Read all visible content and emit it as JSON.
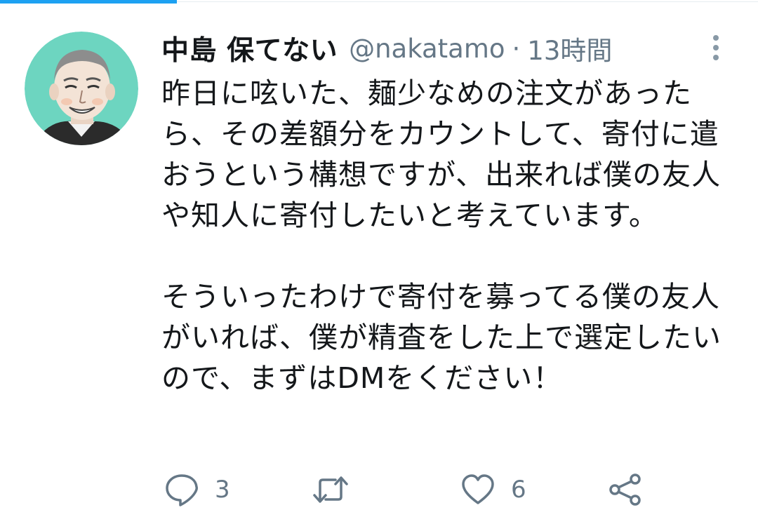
{
  "tweet": {
    "display_name": "中島 保てない",
    "handle": "@nakatamo",
    "separator": "·",
    "time": "13時間",
    "paragraphs": [
      "昨日に呟いた、麺少なめの注文があったら、その差額分をカウントして、寄付に遣おうという構想ですが、出来れば僕の友人や知人に寄付したいと考えています。",
      "そういったわけで寄付を募ってる僕の友人がいれば、僕が精査をした上で選定したいので、まずはDMをください！"
    ],
    "actions": {
      "reply_count": "3",
      "retweet_count": "",
      "like_count": "6"
    }
  },
  "icons": {
    "more": "more-vertical-icon",
    "reply": "reply-icon",
    "retweet": "retweet-icon",
    "like": "heart-icon",
    "share": "share-icon"
  },
  "colors": {
    "accent": "#1da1f2",
    "secondary_text": "#657786",
    "primary_text": "#14171a",
    "avatar_background": "#6dd5c0"
  }
}
